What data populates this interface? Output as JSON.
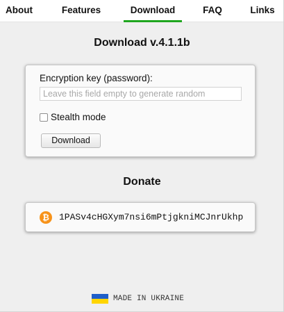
{
  "nav": {
    "tabs": [
      {
        "label": "About"
      },
      {
        "label": "Features"
      },
      {
        "label": "Download",
        "active": true
      },
      {
        "label": "FAQ"
      },
      {
        "label": "Links"
      }
    ],
    "active_color": "#1fa61f"
  },
  "main": {
    "title": "Download v.4.1.1b",
    "form": {
      "key_label": "Encryption key (password):",
      "key_value": "",
      "key_placeholder": "Leave this field empty to generate random",
      "stealth_label": "Stealth mode",
      "stealth_checked": false,
      "download_button": "Download"
    },
    "donate": {
      "heading": "Donate",
      "icon": "bitcoin-icon",
      "icon_glyph": "₿",
      "icon_color": "#f7931a",
      "address": "1PASv4cHGXym7nsi6mPtjgkniMCJnrUkhp"
    }
  },
  "footer": {
    "flag": "ukraine-flag",
    "text": "MADE IN UKRAINE"
  }
}
